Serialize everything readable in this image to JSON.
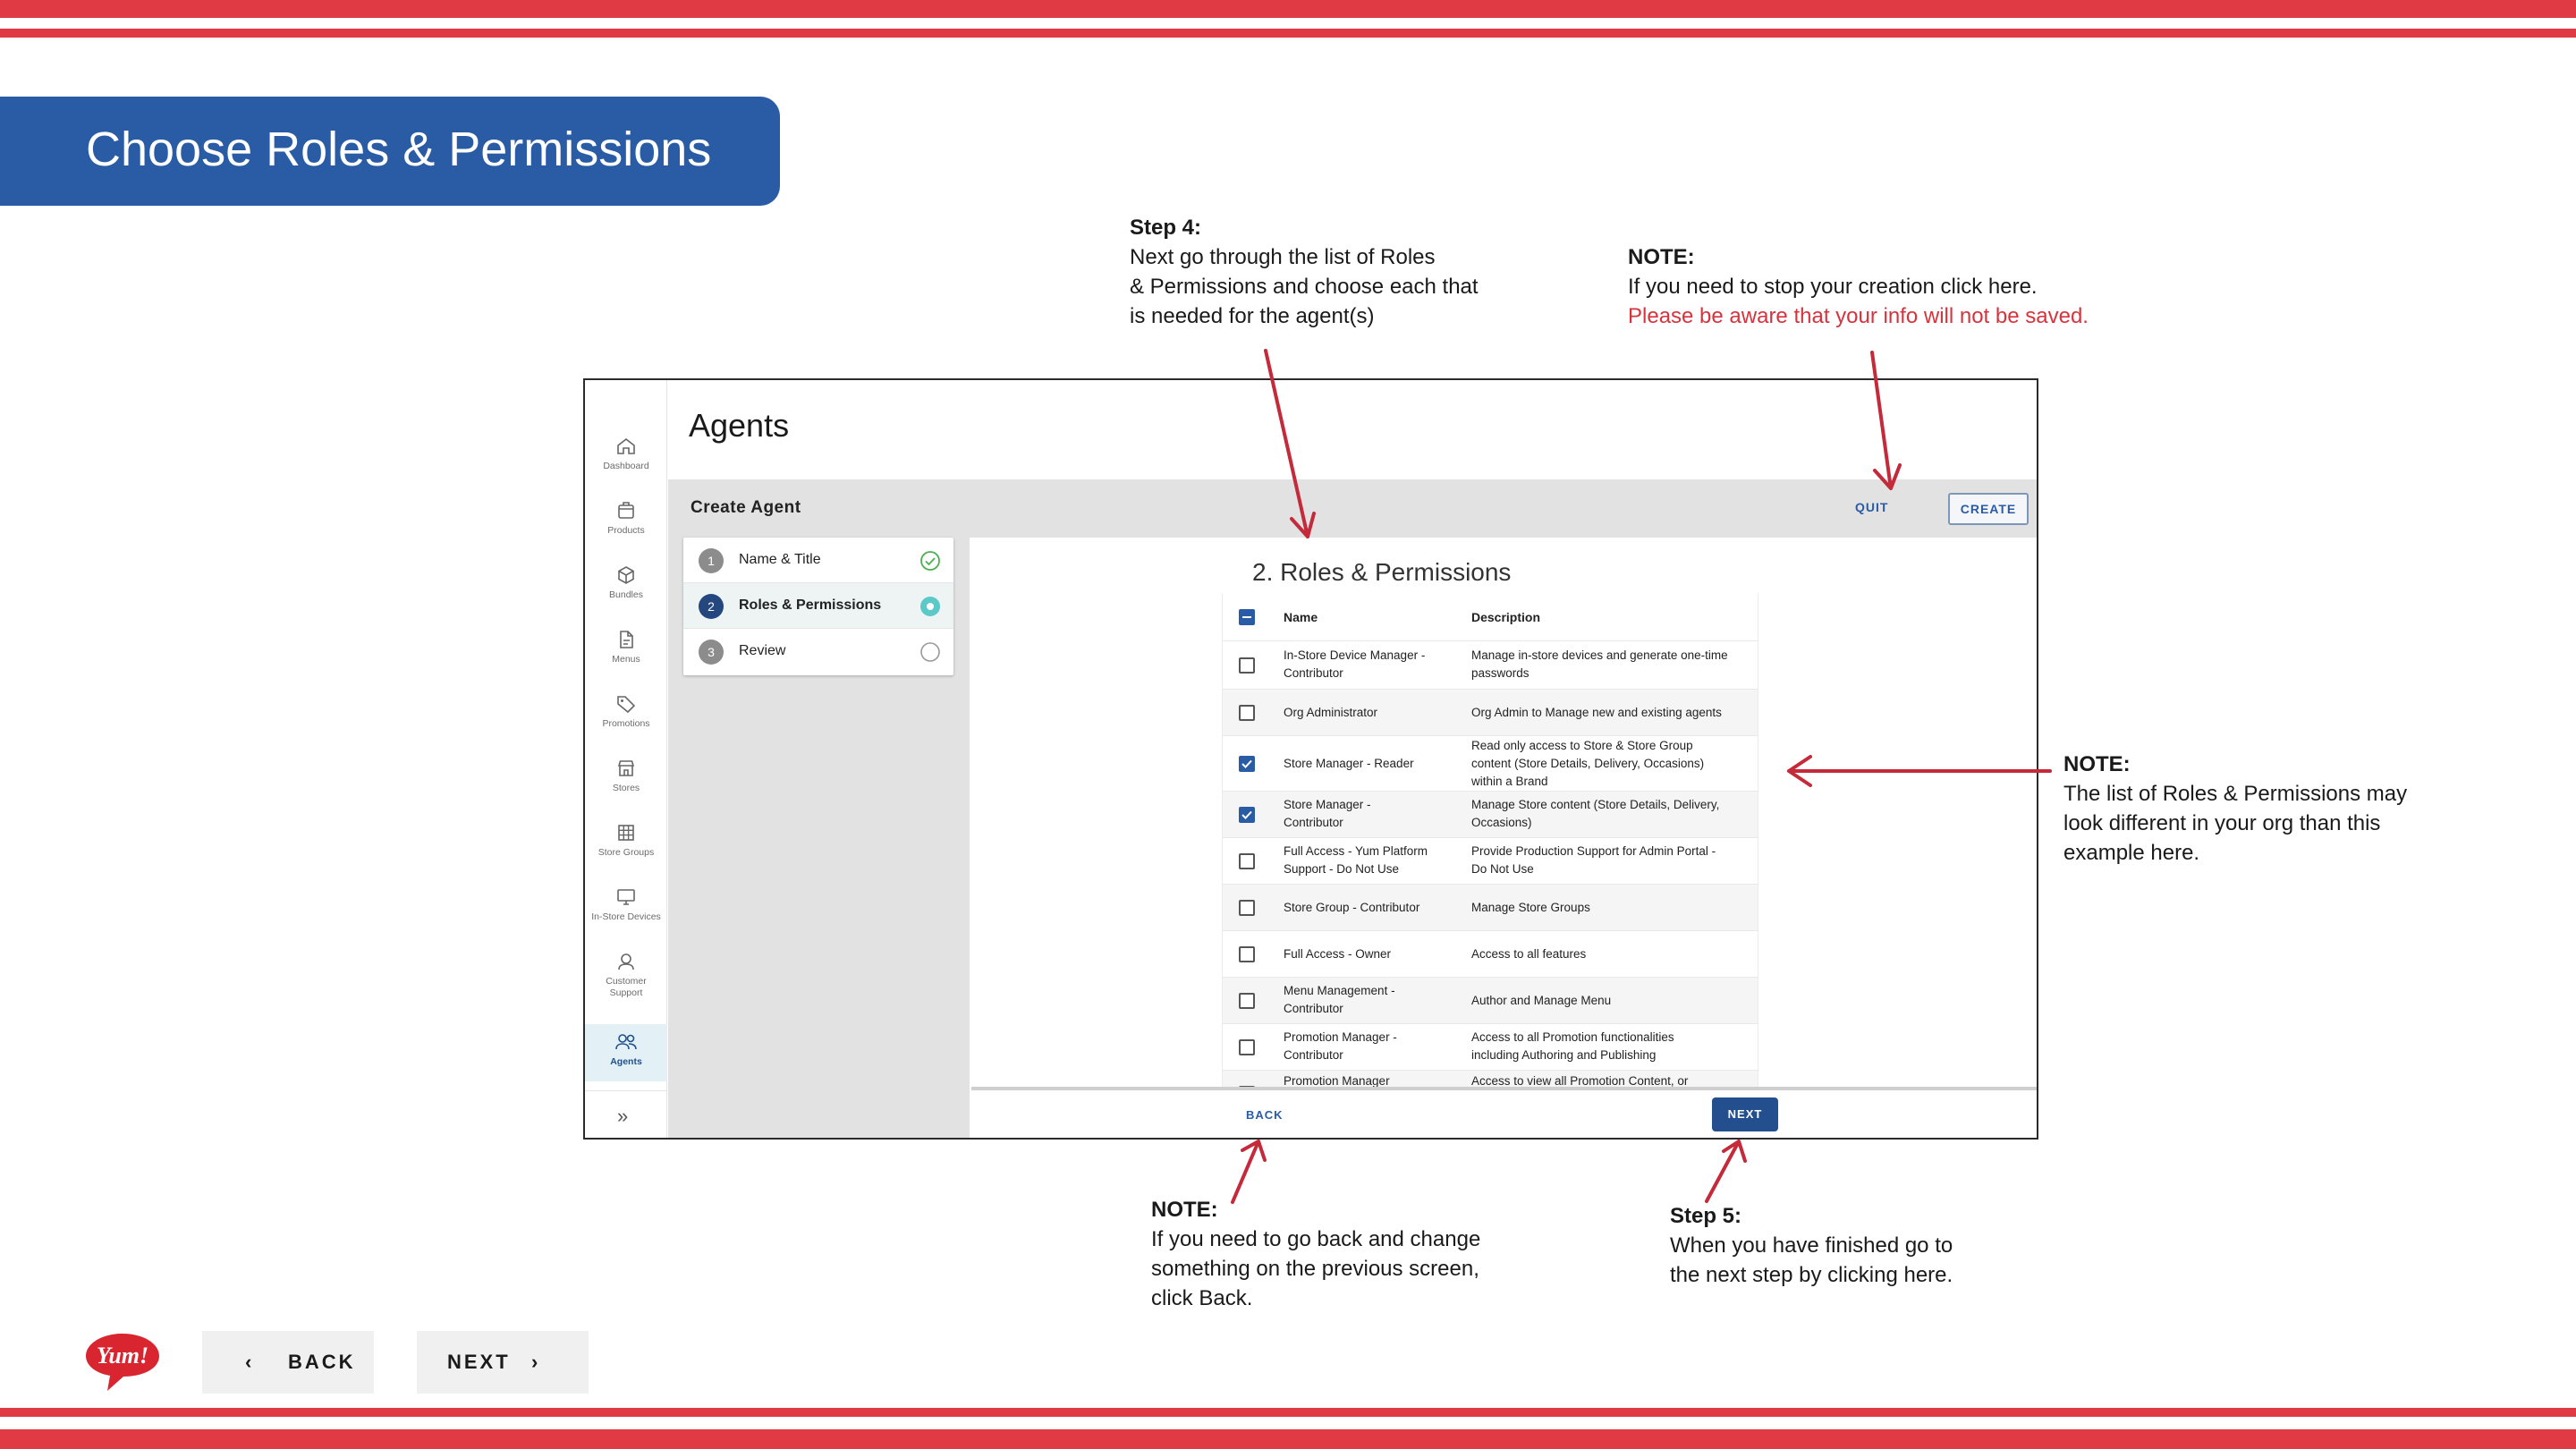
{
  "slide": {
    "title": "Choose Roles & Permissions",
    "back_label": "BACK",
    "next_label": "NEXT",
    "logo_text": "Yum!"
  },
  "annotations": {
    "step4": {
      "heading": "Step 4:",
      "line1": "Next go through the list of Roles",
      "line2": "& Permissions and choose each that",
      "line3": "is needed for the agent(s)"
    },
    "note_quit": {
      "heading": "NOTE:",
      "line1": "If you need to stop your creation click here.",
      "warning": "Please be aware that your info will not be saved."
    },
    "note_list": {
      "heading": "NOTE:",
      "line1": "The list of Roles & Permissions may",
      "line2": "look different in your org than this",
      "line3": "example here."
    },
    "note_back": {
      "heading": "NOTE:",
      "line1": "If you need to go back and change",
      "line2": "something on the previous screen,",
      "line3": "click Back."
    },
    "step5": {
      "heading": "Step 5:",
      "line1": "When you have finished go to",
      "line2": "the next step by clicking here."
    }
  },
  "app": {
    "page_title": "Agents",
    "sidebar": [
      {
        "label": "Dashboard",
        "icon": "home-icon"
      },
      {
        "label": "Products",
        "icon": "box-icon"
      },
      {
        "label": "Bundles",
        "icon": "cube-icon"
      },
      {
        "label": "Menus",
        "icon": "document-icon"
      },
      {
        "label": "Promotions",
        "icon": "tag-icon"
      },
      {
        "label": "Stores",
        "icon": "storefront-icon"
      },
      {
        "label": "Store Groups",
        "icon": "grid-icon"
      },
      {
        "label": "In-Store Devices",
        "icon": "monitor-icon"
      },
      {
        "label": "Customer",
        "label2": "Support",
        "icon": "headset-icon"
      },
      {
        "label": "Agents",
        "icon": "people-icon"
      }
    ],
    "create_agent_label": "Create Agent",
    "quit_label": "QUIT",
    "create_label": "CREATE",
    "steps": [
      {
        "num": "1",
        "label": "Name & Title",
        "status": "complete"
      },
      {
        "num": "2",
        "label": "Roles & Permissions",
        "status": "current"
      },
      {
        "num": "3",
        "label": "Review",
        "status": "pending"
      }
    ],
    "section_title": "2. Roles & Permissions",
    "table": {
      "header": {
        "name": "Name",
        "description": "Description"
      },
      "rows": [
        {
          "name1": "In-Store Device Manager -",
          "name2": "Contributor",
          "desc1": "Manage in-store devices and generate one-time",
          "desc2": "passwords",
          "checked": false
        },
        {
          "name1": "Org Administrator",
          "desc1": "Org Admin to Manage new and existing agents",
          "checked": false
        },
        {
          "name1": "Store Manager - Reader",
          "desc1": "Read only access to Store & Store Group",
          "desc2": "content (Store Details, Delivery, Occasions)",
          "desc3": "within a Brand",
          "checked": true
        },
        {
          "name1": "Store Manager -",
          "name2": "Contributor",
          "desc1": "Manage Store content (Store Details, Delivery,",
          "desc2": "Occasions)",
          "checked": true
        },
        {
          "name1": "Full Access - Yum Platform",
          "name2": "Support - Do Not Use",
          "desc1": "Provide Production Support for Admin Portal -",
          "desc2": "Do Not Use",
          "checked": false
        },
        {
          "name1": "Store Group - Contributor",
          "desc1": "Manage Store Groups",
          "checked": false
        },
        {
          "name1": "Full Access - Owner",
          "desc1": "Access to all features",
          "checked": false
        },
        {
          "name1": "Menu Management -",
          "name2": "Contributor",
          "desc1": "Author and Manage Menu",
          "checked": false
        },
        {
          "name1": "Promotion Manager -",
          "name2": "Contributor",
          "desc1": "Access to all Promotion functionalities",
          "desc2": "including Authoring and Publishing",
          "checked": false
        },
        {
          "name1": "Promotion Manager",
          "desc1": "Access to view all Promotion Content, or",
          "checked": false
        }
      ]
    },
    "back_label": "BACK",
    "next_label": "NEXT"
  },
  "colors": {
    "stripe": "#e03a44",
    "banner": "#2a5ca6",
    "arrow": "#c42a3a",
    "app_primary": "#234f8e"
  }
}
